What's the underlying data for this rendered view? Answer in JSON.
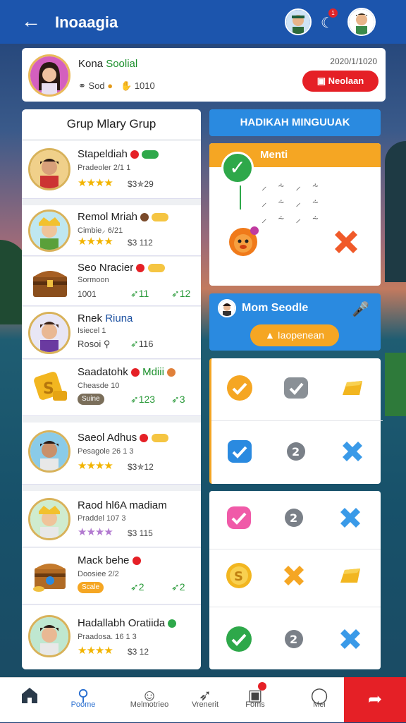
{
  "header": {
    "back_icon": "back-arrow-icon",
    "title": "Inoaagia",
    "notif_count": "1"
  },
  "profile": {
    "name_part1": "Kona ",
    "name_part2": "Soolial",
    "stat1": "Sod",
    "stat2": "1010",
    "timestamp": "2020/1/1020",
    "button_label": "Neolaan"
  },
  "left_panel": {
    "title": "Grup Mlary Grup",
    "rows": [
      {
        "name": "Stapeldiah",
        "sub": "Pradeoler 2/1 1",
        "score": "$3✯29"
      },
      {
        "name": "Remol Mriah",
        "sub": "Cimbie⸝ 6/21",
        "score": "$3 112"
      },
      {
        "name": "Seo Nracier",
        "sub": "Sormoon",
        "val1": "1001",
        "val2": "11",
        "val3": "12"
      },
      {
        "name_a": "Rnek ",
        "name_b": "Riuna",
        "sub": "Isiecel 1",
        "sub2": "Rosoi",
        "val": "116"
      },
      {
        "name_a": "Saadatohk ",
        "name_b": "Mdiii",
        "sub": "Cheasde 10",
        "chip": "Suine",
        "val1": "123",
        "val2": "3"
      },
      {
        "name": "Saeol Adhus",
        "sub": "Pesagole 26 1 3",
        "score": "$3✯12"
      },
      {
        "name": "Raod hl6A madiam",
        "sub": "Praddel 107 3",
        "score": "$3 115"
      },
      {
        "name": "Mack behe",
        "sub": "Doosiee 2/2",
        "chip": "Scale",
        "val1": "2",
        "val2": "2"
      },
      {
        "name": "Hadallabh Oratiida",
        "sub": "Praadosa. 16 1 3",
        "score": "$3 12"
      }
    ]
  },
  "right_panel": {
    "blue_button": "HADIKAH MINGUUAK",
    "menu_title": "Menti",
    "menu_glyphs": "⸝ ⸞ ⸝ ⸞",
    "mic_title": "Mom Seodle",
    "mic_button": "Iaopenean"
  },
  "nav": {
    "items": [
      {
        "label": "",
        "icon": "home-icon"
      },
      {
        "label": "Poome",
        "icon": "search-user-icon"
      },
      {
        "label": "Melmotrieo",
        "icon": "face-icon"
      },
      {
        "label": "Vrenerit",
        "icon": "flex-icon"
      },
      {
        "label": "Foms",
        "icon": "inbox-icon"
      },
      {
        "label": "Mei",
        "icon": "profile-icon"
      }
    ],
    "red_button_icon": "exit-icon"
  },
  "colors": {
    "brand_blue": "#1c55ad",
    "accent_red": "#e52026",
    "accent_orange": "#f5a623",
    "accent_green": "#2ea84a",
    "star": "#f2b400"
  }
}
